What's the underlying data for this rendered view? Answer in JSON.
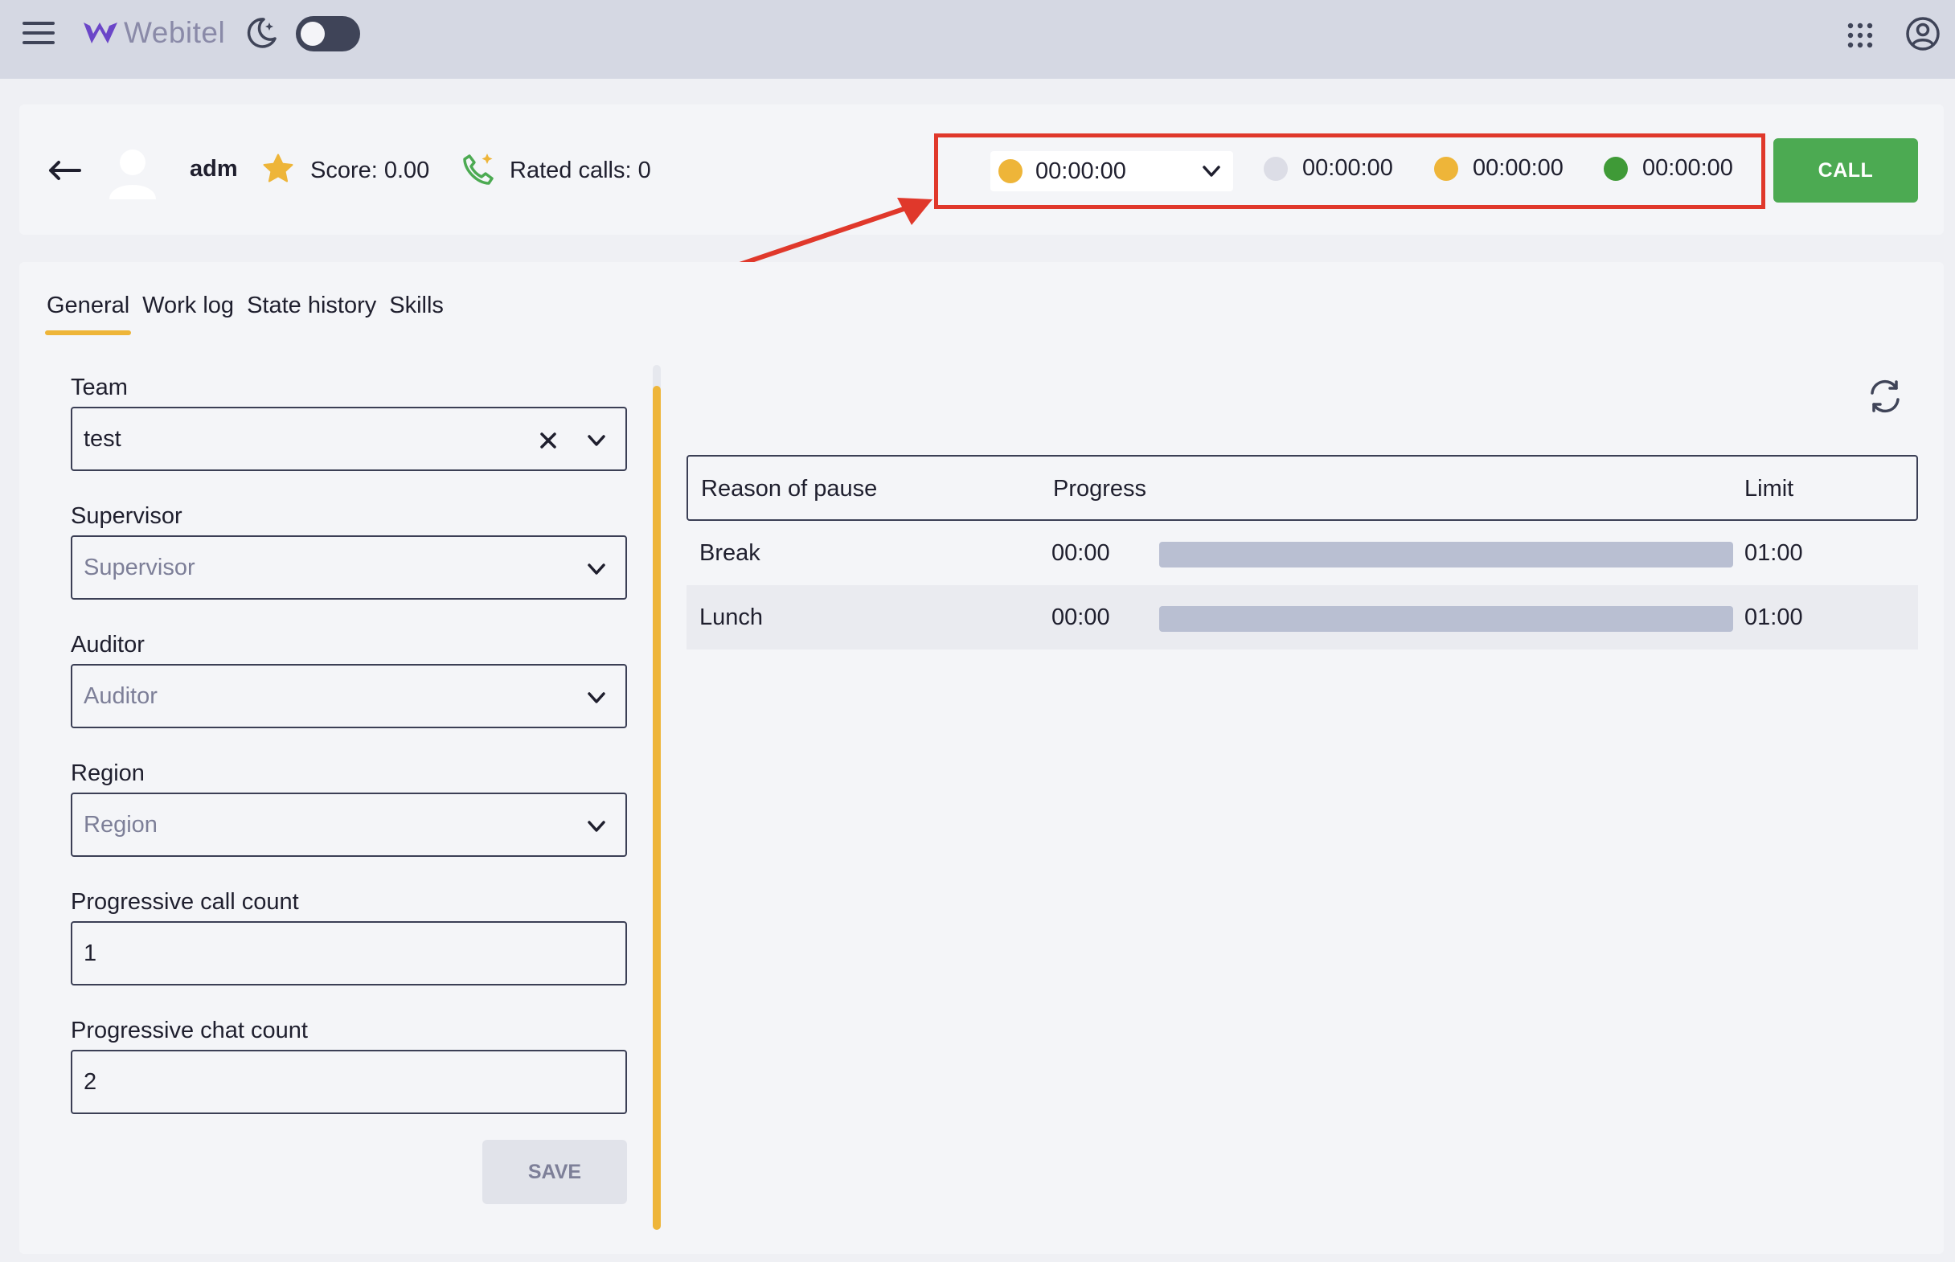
{
  "app": {
    "logo_text": "Webitel"
  },
  "agent": {
    "name": "adm",
    "score_label": "Score: 0.00",
    "rated_calls_label": "Rated calls: 0"
  },
  "status": {
    "selected": {
      "time": "00:00:00",
      "color": "#eeb539"
    },
    "timers": [
      {
        "time": "00:00:00",
        "color": "#dcdde6"
      },
      {
        "time": "00:00:00",
        "color": "#eeb539"
      },
      {
        "time": "00:00:00",
        "color": "#3f9a37"
      }
    ]
  },
  "call_button": "CALL",
  "tabs": [
    "General",
    "Work log",
    "State history",
    "Skills"
  ],
  "form": {
    "team": {
      "label": "Team",
      "value": "test"
    },
    "supervisor": {
      "label": "Supervisor",
      "placeholder": "Supervisor"
    },
    "auditor": {
      "label": "Auditor",
      "placeholder": "Auditor"
    },
    "region": {
      "label": "Region",
      "placeholder": "Region"
    },
    "progressive_call_count": {
      "label": "Progressive call count",
      "value": "1"
    },
    "progressive_chat_count": {
      "label": "Progressive chat count",
      "value": "2"
    },
    "save_label": "SAVE"
  },
  "pause_table": {
    "headers": {
      "reason": "Reason of pause",
      "progress": "Progress",
      "limit": "Limit"
    },
    "rows": [
      {
        "reason": "Break",
        "elapsed": "00:00",
        "limit": "01:00",
        "progress": 0
      },
      {
        "reason": "Lunch",
        "elapsed": "00:00",
        "limit": "01:00",
        "progress": 0
      }
    ]
  },
  "colors": {
    "accent": "#eeb539",
    "call_green": "#4caa52",
    "annotation_red": "#e0382b"
  }
}
